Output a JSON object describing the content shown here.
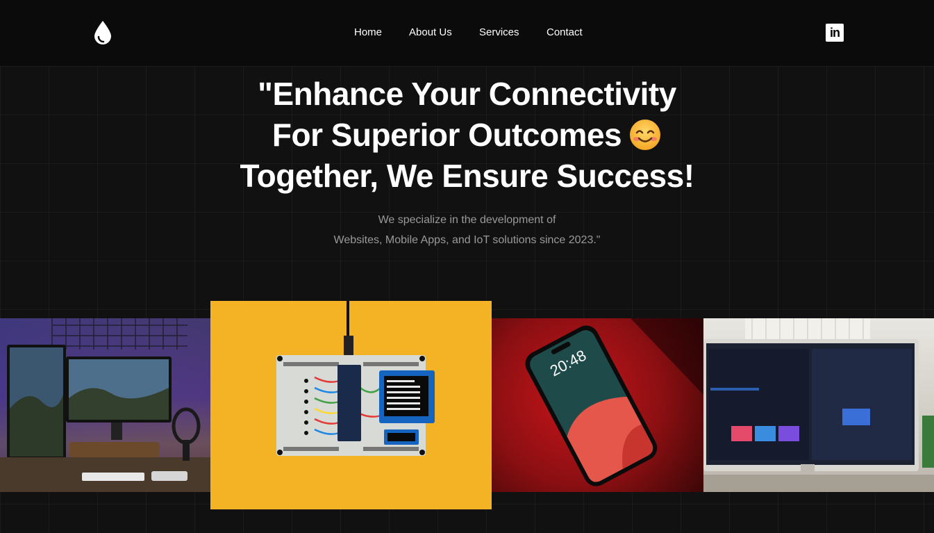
{
  "nav": {
    "logo_icon": "water-drop-icon",
    "links": [
      "Home",
      "About Us",
      "Services",
      "Contact"
    ],
    "social_icon": "linkedin-icon",
    "social_label": "in"
  },
  "hero": {
    "title_line1": "\"Enhance Your Connectivity",
    "title_line2": "For Superior Outcomes",
    "title_emoji": "smiling-face-emoji",
    "title_line3": "Together, We Ensure Success!",
    "subtitle_line1": "We specialize in the development of",
    "subtitle_line2": "Websites, Mobile Apps, and IoT solutions since 2023.\""
  },
  "gallery": {
    "images": [
      "desk-setup-photo",
      "breadboard-iot-photo",
      "smartphone-photo",
      "monitor-workspace-photo"
    ]
  },
  "colors": {
    "background": "#111111",
    "navbar": "#0b0b0b",
    "subtitle": "#9a9a9a",
    "yellow": "#f3b324",
    "red": "#c8151a"
  }
}
